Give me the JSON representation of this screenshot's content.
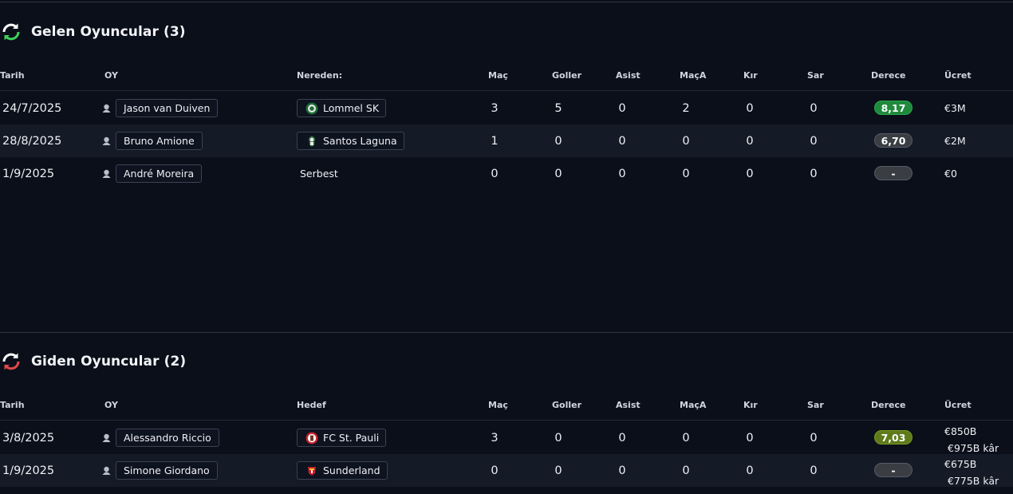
{
  "incoming": {
    "title": "Gelen Oyuncular (3)",
    "headers": {
      "date": "Tarih",
      "player": "OY",
      "club": "Nereden:",
      "apps": "Maç",
      "goals": "Goller",
      "assists": "Asist",
      "motm": "MaçA",
      "red": "Kır",
      "yellow": "Sar",
      "rating": "Derece",
      "fee": "Ücret"
    },
    "rows": [
      {
        "date": "24/7/2025",
        "player": "Jason van Duiven",
        "club": "Lommel SK",
        "club_icon": "lommel-crest-icon",
        "apps": "3",
        "goals": "5",
        "assists": "0",
        "motm": "2",
        "red": "0",
        "yellow": "0",
        "rating": "8,17",
        "rating_color": "#1f8a3c",
        "fee": "€3M"
      },
      {
        "date": "28/8/2025",
        "player": "Bruno Amione",
        "club": "Santos Laguna",
        "club_icon": "santos-crest-icon",
        "apps": "1",
        "goals": "0",
        "assists": "0",
        "motm": "0",
        "red": "0",
        "yellow": "0",
        "rating": "6,70",
        "rating_color": "#3a3d42",
        "fee": "€2M"
      },
      {
        "date": "1/9/2025",
        "player": "André Moreira",
        "club": "Serbest",
        "club_icon": "",
        "apps": "0",
        "goals": "0",
        "assists": "0",
        "motm": "0",
        "red": "0",
        "yellow": "0",
        "rating": "-",
        "rating_color": "#3a3d42",
        "fee": "€0"
      }
    ]
  },
  "outgoing": {
    "title": "Giden Oyuncular (2)",
    "headers": {
      "date": "Tarih",
      "player": "OY",
      "club": "Hedef",
      "apps": "Maç",
      "goals": "Goller",
      "assists": "Asist",
      "motm": "MaçA",
      "red": "Kır",
      "yellow": "Sar",
      "rating": "Derece",
      "fee": "Ücret"
    },
    "rows": [
      {
        "date": "3/8/2025",
        "player": "Alessandro Riccio",
        "club": "FC St. Pauli",
        "club_icon": "st-pauli-crest-icon",
        "apps": "3",
        "goals": "0",
        "assists": "0",
        "motm": "0",
        "red": "0",
        "yellow": "0",
        "rating": "7,03",
        "rating_color": "#5e7a1a",
        "fee": "€850B",
        "profit": "€975B kâr"
      },
      {
        "date": "1/9/2025",
        "player": "Simone Giordano",
        "club": "Sunderland",
        "club_icon": "sunderland-crest-icon",
        "apps": "0",
        "goals": "0",
        "assists": "0",
        "motm": "0",
        "red": "0",
        "yellow": "0",
        "rating": "-",
        "rating_color": "#3a3d42",
        "fee": "€675B",
        "profit": "€775B kâr"
      }
    ]
  },
  "colors": {
    "incoming_accent": "#3ecf5a",
    "outgoing_accent": "#e0484a",
    "background": "#0b0f1a"
  }
}
